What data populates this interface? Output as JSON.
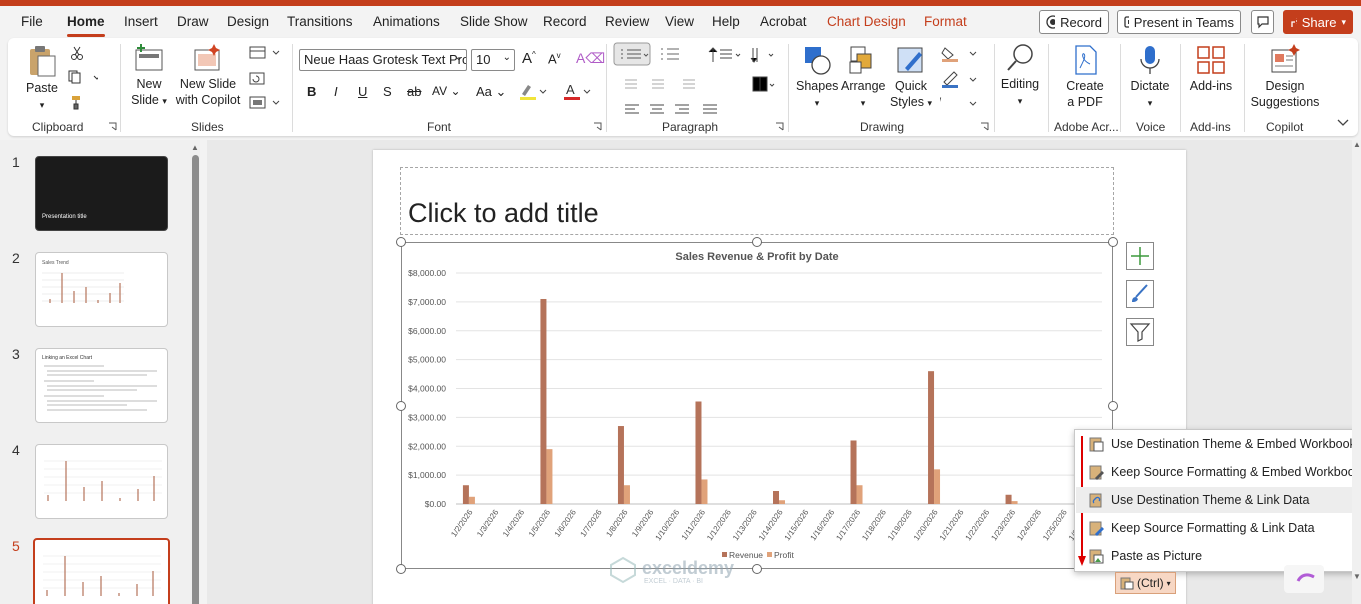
{
  "tabs": [
    "File",
    "Home",
    "Insert",
    "Draw",
    "Design",
    "Transitions",
    "Animations",
    "Slide Show",
    "Record",
    "Review",
    "View",
    "Help",
    "Acrobat",
    "Chart Design",
    "Format"
  ],
  "active_tab": "Home",
  "topbar": {
    "record": "Record",
    "present": "Present in Teams",
    "share": "Share"
  },
  "ribbon": {
    "clipboard": {
      "paste": "Paste",
      "label": "Clipboard"
    },
    "slides": {
      "new_slide_1": "New",
      "new_slide_2": "Slide",
      "copilot_1": "New Slide",
      "copilot_2": "with Copilot",
      "label": "Slides"
    },
    "font": {
      "name": "Neue Haas Grotesk Text Pro",
      "size": "10",
      "label": "Font"
    },
    "paragraph": {
      "label": "Paragraph"
    },
    "drawing": {
      "shapes": "Shapes",
      "arrange": "Arrange",
      "quick_1": "Quick",
      "quick_2": "Styles",
      "label": "Drawing"
    },
    "editing": {
      "label": "Editing"
    },
    "adobe": {
      "create_1": "Create",
      "create_2": "a PDF",
      "label": "Adobe Acr..."
    },
    "voice": {
      "dictate": "Dictate",
      "label": "Voice"
    },
    "addins": {
      "btn": "Add-ins",
      "label": "Add-ins"
    },
    "copilot": {
      "design_1": "Design",
      "design_2": "Suggestions",
      "label": "Copilot"
    }
  },
  "slides_panel": {
    "numbers": [
      "1",
      "2",
      "3",
      "4",
      "5"
    ],
    "slide1_title": "Presentation title",
    "slide2_title": "Sales Trend",
    "slide3_title": "Linking an Excel Chart"
  },
  "slide": {
    "title_placeholder": "Click to add title"
  },
  "chart_data": {
    "type": "bar",
    "title": "Sales Revenue & Profit by Date",
    "categories": [
      "1/2/2026",
      "1/3/2026",
      "1/4/2026",
      "1/5/2026",
      "1/6/2026",
      "1/7/2026",
      "1/8/2026",
      "1/9/2026",
      "1/10/2026",
      "1/11/2026",
      "1/12/2026",
      "1/13/2026",
      "1/14/2026",
      "1/15/2026",
      "1/16/2026",
      "1/17/2026",
      "1/18/2026",
      "1/19/2026",
      "1/20/2026",
      "1/21/2026",
      "1/22/2026",
      "1/23/2026",
      "1/24/2026",
      "1/25/2026",
      "1/26/2026"
    ],
    "series": [
      {
        "name": "Revenue",
        "color": "#b5735a",
        "values": [
          650,
          0,
          0,
          7100,
          0,
          0,
          2700,
          0,
          0,
          3550,
          0,
          0,
          450,
          0,
          0,
          2200,
          0,
          0,
          4600,
          0,
          0,
          320,
          0,
          0,
          0
        ]
      },
      {
        "name": "Profit",
        "color": "#e0a27a",
        "values": [
          250,
          0,
          0,
          1900,
          0,
          0,
          650,
          0,
          0,
          850,
          0,
          0,
          130,
          0,
          0,
          650,
          0,
          0,
          1200,
          0,
          0,
          100,
          0,
          0,
          0
        ]
      }
    ],
    "yticks": [
      "$0.00",
      "$1,000.00",
      "$2,000.00",
      "$3,000.00",
      "$4,000.00",
      "$5,000.00",
      "$6,000.00",
      "$7,000.00",
      "$8,000.00"
    ],
    "ylim": [
      0,
      8000
    ],
    "legend_position": "bottom"
  },
  "paste_menu": {
    "items": [
      "Use Destination Theme & Embed Workbook",
      "Keep Source Formatting & Embed Workbook",
      "Use Destination Theme & Link Data",
      "Keep Source Formatting & Link Data",
      "Paste as Picture"
    ],
    "highlighted_index": 2,
    "ctrl_label": "(Ctrl)"
  },
  "watermark": {
    "name": "exceldemy",
    "tagline": "EXCEL · DATA · BI"
  }
}
